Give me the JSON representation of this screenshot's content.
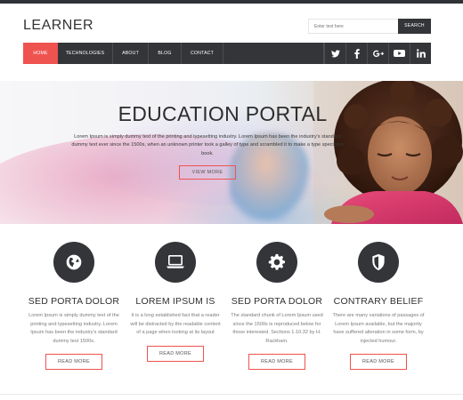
{
  "header": {
    "logo": "LEARNER",
    "search": {
      "placeholder": "Enter text here",
      "button_label": "SEARCH"
    }
  },
  "nav": {
    "items": [
      {
        "label": "HOME",
        "active": true
      },
      {
        "label": "TECHNOLOGIES",
        "active": false
      },
      {
        "label": "ABOUT",
        "active": false
      },
      {
        "label": "BLOG",
        "active": false
      },
      {
        "label": "CONTACT",
        "active": false
      }
    ],
    "social": [
      {
        "icon": "twitter-icon",
        "glyph": "t"
      },
      {
        "icon": "facebook-icon",
        "glyph": "f"
      },
      {
        "icon": "google-plus-icon",
        "glyph": "g+"
      },
      {
        "icon": "youtube-icon",
        "glyph": "You Tube"
      },
      {
        "icon": "linkedin-icon",
        "glyph": "in"
      }
    ]
  },
  "hero": {
    "title": "EDUCATION PORTAL",
    "text": "Lorem Ipsum is simply dummy text of the printing and typesetting industry. Lorem Ipsum has been the industry's standard dummy text ever since the 1500s, when an unknown printer took a galley of type and scrambled it to make a type specimen book.",
    "button_label": "VIEW MORE"
  },
  "features": [
    {
      "icon": "globe-icon",
      "title": "SED PORTA DOLOR",
      "text": "Lorem Ipsum is simply dummy text of the printing and typesetting industry. Lorem Ipsum has been the industry's standard dummy text 1500s.",
      "button_label": "READ MORE"
    },
    {
      "icon": "laptop-icon",
      "title": "LOREM IPSUM IS",
      "text": "It is a long established fact that a reader will be distracted by the readable content of a page when looking at its layout",
      "button_label": "READ MORE"
    },
    {
      "icon": "gear-icon",
      "title": "SED PORTA DOLOR",
      "text": "The standard chunk of Lorem Ipsum used since the 1500s is reproduced below for those interested. Sections 1.10.32 by H. Rackham.",
      "button_label": "READ MORE"
    },
    {
      "icon": "shield-icon",
      "title": "CONTRARY BELIEF",
      "text": "There are many variations of passages of Lorem Ipsum available, but the majority have suffered alteration in some form, by injected humour.",
      "button_label": "READ MORE"
    }
  ],
  "colors": {
    "accent": "#ef5350",
    "dark": "#333538"
  }
}
